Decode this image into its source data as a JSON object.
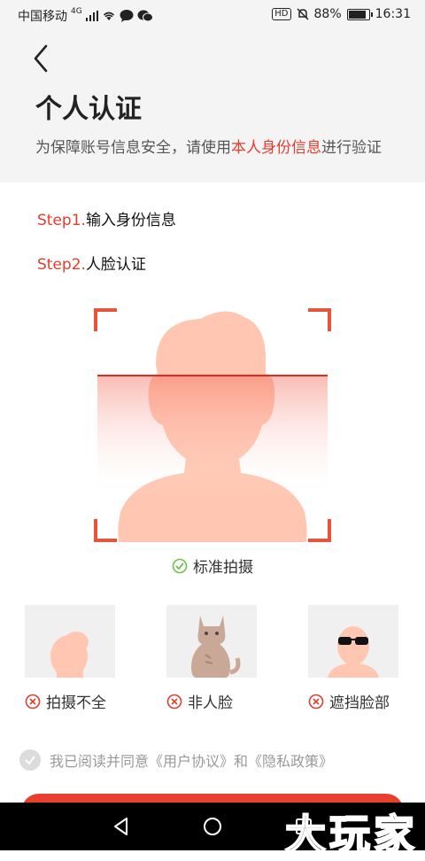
{
  "status_bar": {
    "carrier": "中国移动",
    "network": "4G",
    "battery": "88%",
    "battery_level": 0.88,
    "time": "16:31",
    "hd_badge": "HD"
  },
  "header": {
    "title": "个人认证",
    "subtitle_pre": "为保障账号信息安全，请使用",
    "subtitle_highlight": "本人身份信息",
    "subtitle_post": "进行验证"
  },
  "steps": [
    {
      "no": "Step1.",
      "text": "输入身份信息"
    },
    {
      "no": "Step2.",
      "text": "人脸认证"
    }
  ],
  "standard_label": "标准拍摄",
  "examples": [
    {
      "label": "拍摄不全"
    },
    {
      "label": "非人脸"
    },
    {
      "label": "遮挡脸部"
    }
  ],
  "agreement": {
    "text": "我已阅读并同意《用户协议》和《隐私政策》"
  },
  "watermark": "大玩家",
  "colors": {
    "accent": "#e33d2e",
    "face": "#ffc7b1",
    "success": "#6cc24a"
  }
}
